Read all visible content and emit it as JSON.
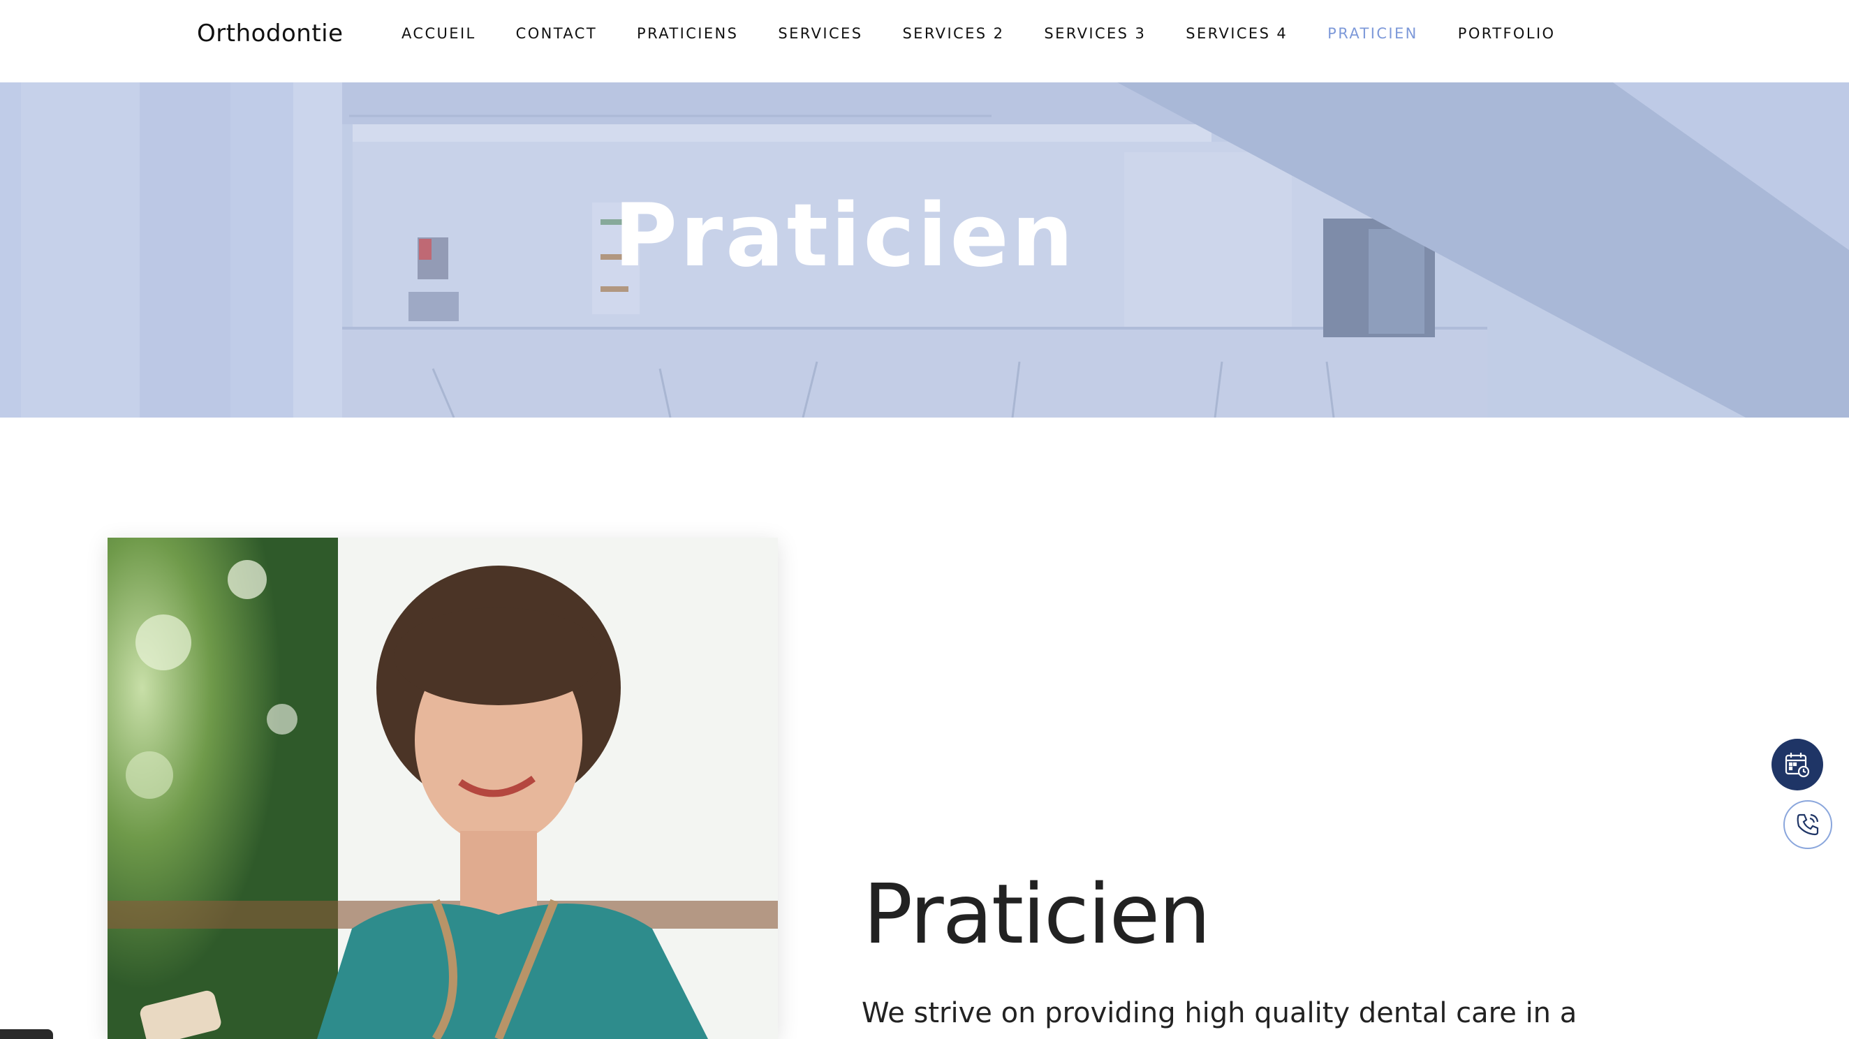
{
  "header": {
    "logo": "Orthodontie",
    "nav": [
      {
        "label": "ACCUEIL",
        "active": false
      },
      {
        "label": "CONTACT",
        "active": false
      },
      {
        "label": "PRATICIENS",
        "active": false
      },
      {
        "label": "SERVICES",
        "active": false
      },
      {
        "label": "SERVICES 2",
        "active": false
      },
      {
        "label": "SERVICES 3",
        "active": false
      },
      {
        "label": "SERVICES 4",
        "active": false
      },
      {
        "label": "PRATICIEN",
        "active": true
      },
      {
        "label": "PORTFOLIO",
        "active": false
      }
    ],
    "active_color": "#7d99d9"
  },
  "hero": {
    "title": "Praticien",
    "image": "clinic-interior-photo"
  },
  "main": {
    "image": "smiling-woman-photo",
    "title": "Praticien",
    "text": "We strive on providing high quality dental care in a"
  },
  "floating": {
    "calendar_icon": "calendar-clock-icon",
    "phone_icon": "phone-icon",
    "calendar_color": "#1f3566",
    "phone_border": "#8aa6dc"
  }
}
